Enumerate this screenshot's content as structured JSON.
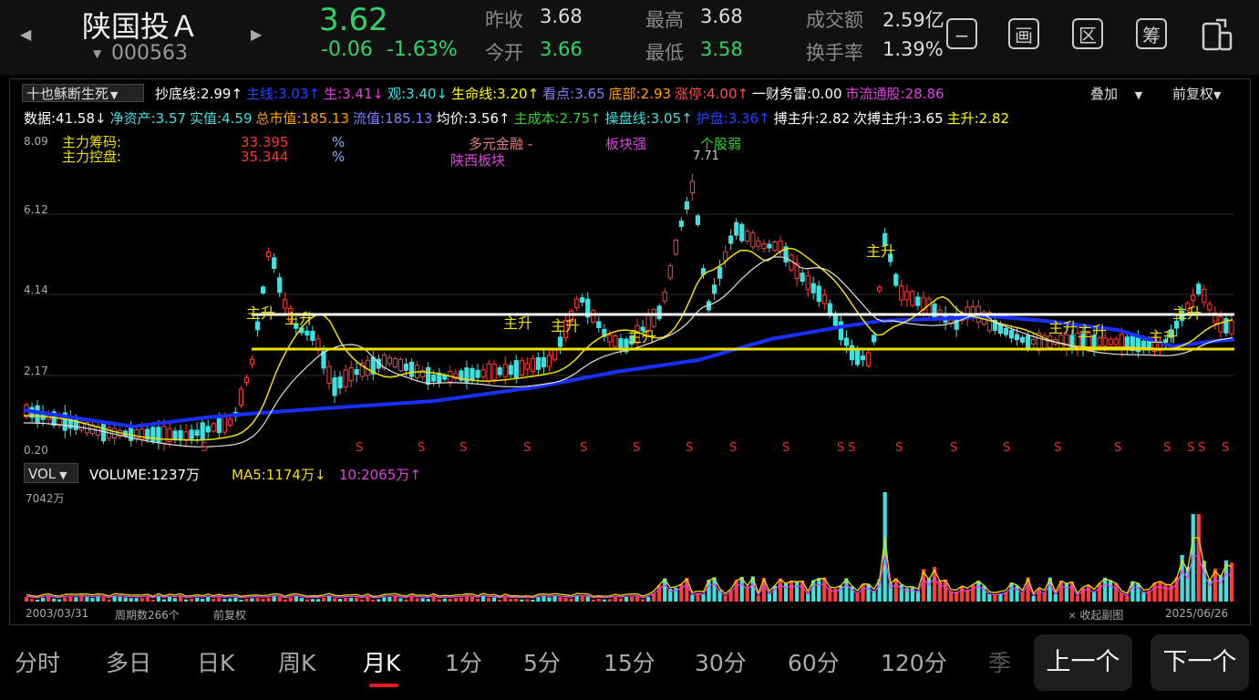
{
  "stock": {
    "name": "陕国投Ａ",
    "code": "000563",
    "price": "3.62",
    "change": "-0.06",
    "change_pct": "-1.63%"
  },
  "stats": {
    "prev_close_label": "昨收",
    "prev_close": "3.68",
    "open_label": "今开",
    "open": "3.66",
    "high_label": "最高",
    "high": "3.68",
    "low_label": "最低",
    "low": "3.58",
    "turnover_label": "成交额",
    "turnover": "2.59亿",
    "turnover_rate_label": "换手率",
    "turnover_rate": "1.39%"
  },
  "header_icons": [
    "minus-icon",
    "draw-icon",
    "zone-icon",
    "chip-icon",
    "phone-icon"
  ],
  "header_icon_glyphs": {
    "draw": "画",
    "zone": "区",
    "chip": "筹"
  },
  "indicator_select": "十也稣断生死",
  "indicators_row1": [
    {
      "text": "抄底线:2.99↑",
      "color": "#ffffff"
    },
    {
      "text": "主线:3.03↑",
      "color": "#2244ff"
    },
    {
      "text": "生:3.41↓",
      "color": "#e040e0"
    },
    {
      "text": "观:3.40↓",
      "color": "#40e0e0"
    },
    {
      "text": "生命线:3.20↑",
      "color": "#ffff00"
    },
    {
      "text": "看点:3.65",
      "color": "#8080ff"
    },
    {
      "text": "底部:2.93",
      "color": "#ffa000"
    },
    {
      "text": "涨停:4.00↑",
      "color": "#ff5050"
    },
    {
      "text": "一财务雷:0.00",
      "color": "#ffffff"
    },
    {
      "text": "市流通股:28.86",
      "color": "#e040e0"
    }
  ],
  "indicators_row2": [
    {
      "text": "数据:41.58↓",
      "color": "#ffffff"
    },
    {
      "text": "净资产:3.57",
      "color": "#40e0e0"
    },
    {
      "text": "实值:4.59",
      "color": "#40e0e0"
    },
    {
      "text": "总市值:185.13",
      "color": "#ffa000"
    },
    {
      "text": "流值:185.13",
      "color": "#8080ff"
    },
    {
      "text": "均价:3.56↑",
      "color": "#ffffff"
    },
    {
      "text": "主成本:2.75↑",
      "color": "#30d030"
    },
    {
      "text": "操盘线:3.05↑",
      "color": "#40e0e0"
    },
    {
      "text": "护盘:3.36↑",
      "color": "#2244ff"
    },
    {
      "text": "搏主升:2.82",
      "color": "#ffffff"
    },
    {
      "text": "次搏主升:3.65",
      "color": "#ffffff"
    },
    {
      "text": "主升:2.82",
      "color": "#ffff00"
    }
  ],
  "overlay_label": "叠加",
  "adjust_label": "前复权",
  "chip_rows": [
    {
      "label": "主力筹码:",
      "value": "33.395",
      "pct": "%"
    },
    {
      "label": "主力控盘:",
      "value": "35.344",
      "pct": "%"
    }
  ],
  "sector": {
    "a": "多元金融 -",
    "b": "板块强",
    "c": "个股弱",
    "d": "陕西板块"
  },
  "price_axis": [
    "8.09",
    "6.12",
    "4.14",
    "2.17",
    "0.20"
  ],
  "peak_label": "7.71",
  "main_rise_label": "主升",
  "sell_mark": "S",
  "volume": {
    "select": "VOL",
    "vol": "VOLUME:1237万",
    "ma5": "MA5:1174万↓",
    "ma10": "10:2065万↑",
    "axis_top": "7042万"
  },
  "footer": {
    "start_date": "2003/03/31",
    "periods": "周期数266个",
    "adjust": "前复权",
    "collapse": "收起副图",
    "end_date": "2025/06/26"
  },
  "tabs": [
    "分时",
    "多日",
    "日K",
    "周K",
    "月K",
    "1分",
    "5分",
    "15分",
    "30分",
    "60分",
    "120分",
    "季"
  ],
  "active_tab": "月K",
  "nav": {
    "prev": "上一个",
    "next": "下一个"
  },
  "colors": {
    "up": "#ff3b3b",
    "down": "#3ee0e0",
    "accent_green": "#2fd36a",
    "ma_yellow": "#f0e000",
    "ma_blue": "#1830ff"
  }
}
